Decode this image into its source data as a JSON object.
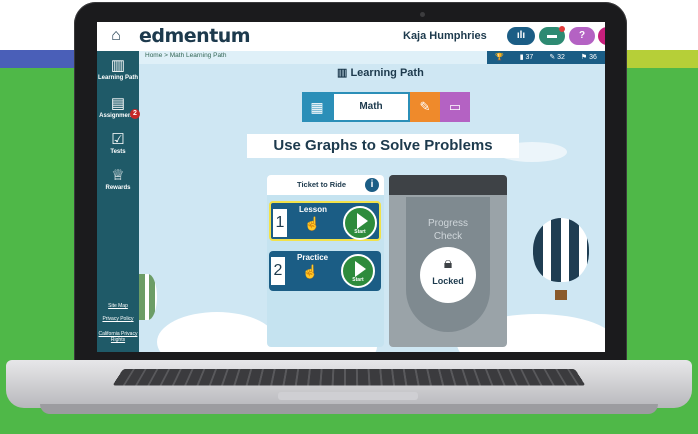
{
  "header": {
    "logo": "edmentum",
    "user_name": "Kaja Humphries",
    "buttons": [
      "progress",
      "messages",
      "help",
      "logout"
    ]
  },
  "sidebar": {
    "items": [
      {
        "label": "Learning Path",
        "icon": "map-icon"
      },
      {
        "label": "Assignments",
        "icon": "assignments-icon",
        "badge": "2"
      },
      {
        "label": "Tests",
        "icon": "tests-icon"
      },
      {
        "label": "Rewards",
        "icon": "trophy-icon"
      }
    ],
    "links": [
      "Site Map",
      "Privacy Policy",
      "California Privacy Rights"
    ]
  },
  "breadcrumb": "Home > Math Learning Path",
  "stats": {
    "trophies": "",
    "books": "37",
    "pencils": "32",
    "flags": "36"
  },
  "learning_path_title": "Learning Path",
  "subject": {
    "name": "Math"
  },
  "unit_title": "Use Graphs to Solve Problems",
  "ticket": {
    "title": "Ticket to Ride",
    "steps": [
      {
        "num": "1",
        "label": "Lesson",
        "action": "Start"
      },
      {
        "num": "2",
        "label": "Practice",
        "action": "Start"
      }
    ]
  },
  "progress_check": {
    "line1": "Progress",
    "line2": "Check",
    "status": "Locked"
  }
}
